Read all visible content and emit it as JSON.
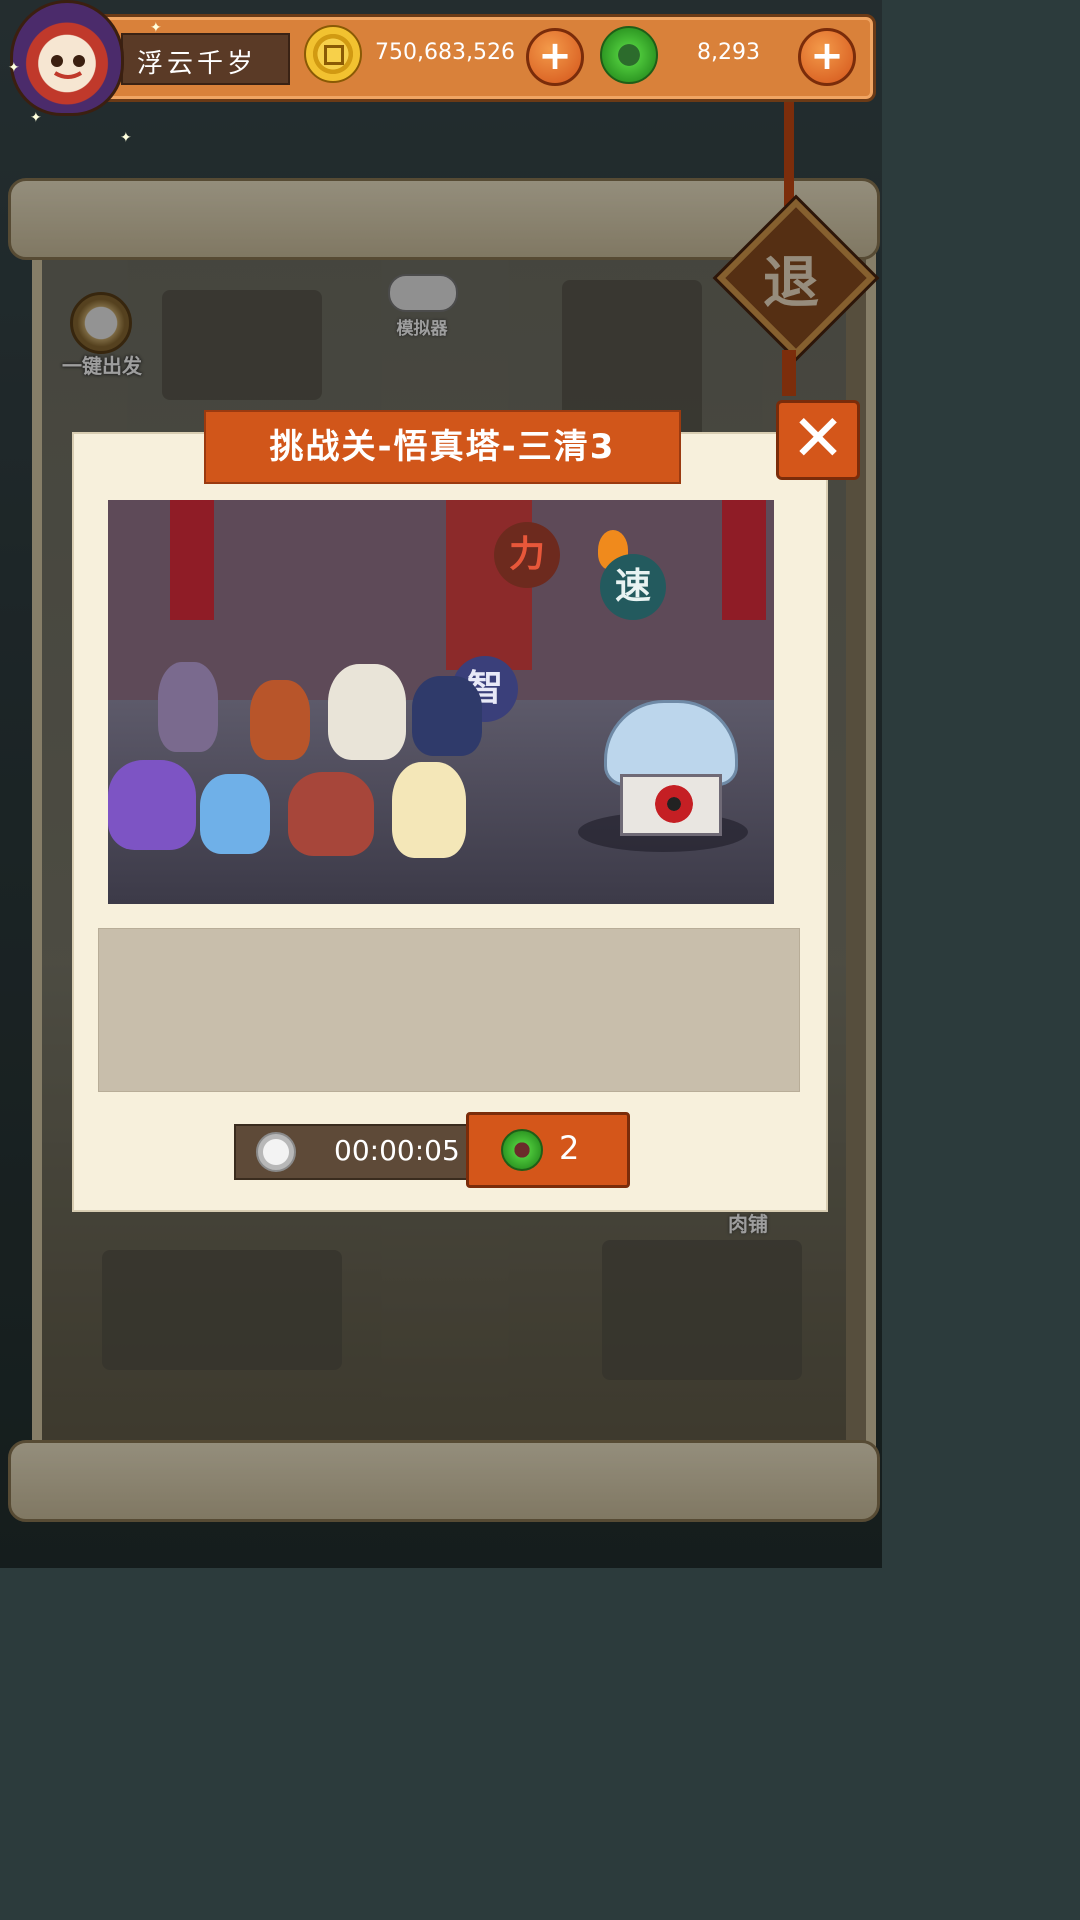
{
  "player": {
    "name": "浮云千岁"
  },
  "currency": {
    "coins": "750,683,526",
    "jade": "8,293",
    "plus_label": "+"
  },
  "map": {
    "one_click_go": "一键出发",
    "emulator": "模拟器",
    "shop": "肉铺",
    "exit": "退"
  },
  "dialog": {
    "title": "挑战关-悟真塔-三清3",
    "close": "✕",
    "badges": {
      "strength": "力",
      "speed": "速",
      "wisdom": "智"
    },
    "description": "",
    "timer": "00:00:05",
    "cost": "2"
  },
  "colors": {
    "accent": "#d4561a",
    "top_bar": "#d9813a",
    "panel": "#f7f0dc"
  }
}
